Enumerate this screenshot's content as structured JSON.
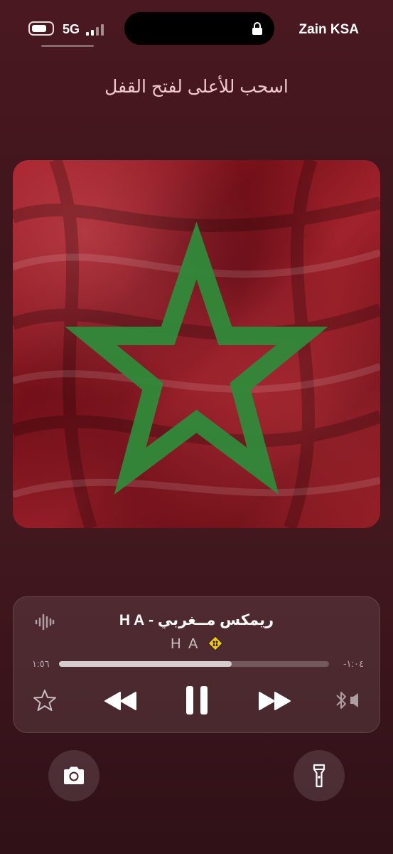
{
  "status_bar": {
    "network": "5G",
    "carrier": "Zain KSA",
    "battery_level": 0.75,
    "icons": [
      "battery-icon",
      "signal-icon",
      "lock-icon"
    ]
  },
  "lock_screen": {
    "swipe_hint": "اسحب للأعلى لفتح القفل"
  },
  "now_playing": {
    "album_art": "morocco-flag-artwork",
    "title": "ريمكس مــغربي - H A",
    "artist": "H A",
    "artist_badge_icon": "warning-sign-icon",
    "time_elapsed": "١:٥٦",
    "time_remaining": "-١:٠٤",
    "progress": 0.64,
    "controls": [
      "star-icon",
      "rewind-icon",
      "pause-icon",
      "forward-icon",
      "airplay-icon"
    ]
  },
  "quick_actions": [
    "camera-icon",
    "flashlight-icon"
  ],
  "colors": {
    "background": "#43181f",
    "flag_red": "#9e1c26",
    "flag_green": "#2f8a3a"
  }
}
